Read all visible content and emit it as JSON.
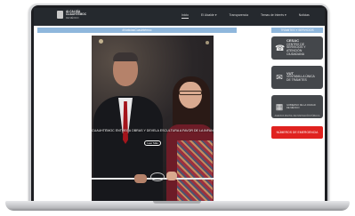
{
  "header": {
    "logo_title": "ALCALDÍA CUAUHTÉMOC",
    "logo_subtitle": "DE MÉXICO",
    "nav": [
      {
        "label": "Inicio",
        "active": true
      },
      {
        "label": "El Alcalde ▾",
        "active": false
      },
      {
        "label": "Transparencia",
        "active": false
      },
      {
        "label": "Temas de Interés ▾",
        "active": false
      },
      {
        "label": "Noticias",
        "active": false
      }
    ]
  },
  "main": {
    "hashtag": "#NoticiasCuauhtémoc",
    "hero": {
      "caption": "CUAUHTÉMOC ENTREGA OBRAS Y DEVELA ESCULTURA A FAVOR DE LA INFANCIA",
      "button_label": "Leer Más"
    }
  },
  "sidebar": {
    "header": "TRÁMITES Y SERVICIOS",
    "cards": [
      {
        "icon": "phone-headset-icon",
        "title": "CESAC",
        "subtitle": "CENTRO DE SERVICIOS Y ATENCIÓN CIUDADANA",
        "footer": ""
      },
      {
        "icon": "document-check-icon",
        "title": "VUT",
        "subtitle": "VENTANILLA ÚNICA DE TRÁMITES",
        "footer": ""
      },
      {
        "icon": "city-government-icon",
        "title": "GOBIERNO DE LA CIUDAD DE MÉXICO",
        "subtitle": "",
        "footer": "AGENCIA DIGITAL DE INNOVACIÓN PÚBLICA"
      }
    ],
    "emergency_label": "NÚMEROS DE EMERGENCIA"
  },
  "colors": {
    "header_bg": "#25292e",
    "accent_blue": "#8fb7dc",
    "card_bg": "#44474b",
    "emergency_red": "#e0221f"
  }
}
